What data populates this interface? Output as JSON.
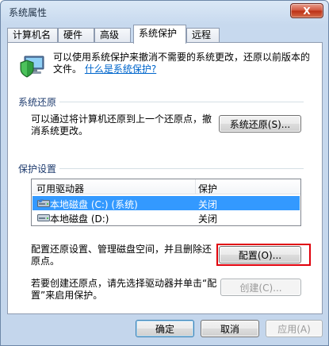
{
  "window": {
    "title": "系统属性",
    "close_glyph": "X"
  },
  "tabs": [
    {
      "label": "计算机名"
    },
    {
      "label": "硬件"
    },
    {
      "label": "高级"
    },
    {
      "label": "系统保护",
      "active": true
    },
    {
      "label": "远程"
    }
  ],
  "intro": {
    "text": "可以使用系统保护来撤消不需要的系统更改，还原以前版本的文件。",
    "link": "什么是系统保护?"
  },
  "restore_group": {
    "label": "系统还原",
    "desc": "可以通过将计算机还原到上一个还原点，撤消系统更改。",
    "button": "系统还原(S)..."
  },
  "protection_group": {
    "label": "保护设置",
    "columns": [
      "可用驱动器",
      "保护"
    ],
    "rows": [
      {
        "drive": "本地磁盘 (C:) (系统)",
        "status": "关闭",
        "selected": true
      },
      {
        "drive": "本地磁盘 (D:)",
        "status": "关闭",
        "selected": false
      }
    ],
    "configure_desc": "配置还原设置、管理磁盘空间，并且删除还原点。",
    "configure_button": "配置(O)...",
    "create_desc": "若要创建还原点，请先选择驱动器并单击“配置”来启用保护。",
    "create_button": "创建(C)..."
  },
  "footer": {
    "ok": "确定",
    "cancel": "取消",
    "apply": "应用(A)"
  },
  "colors": {
    "selection": "#3399ff",
    "highlight": "#e0000b",
    "link": "#0066cc"
  },
  "icons": [
    "shield-computer-icon",
    "hard-drive-icon",
    "close-icon"
  ]
}
